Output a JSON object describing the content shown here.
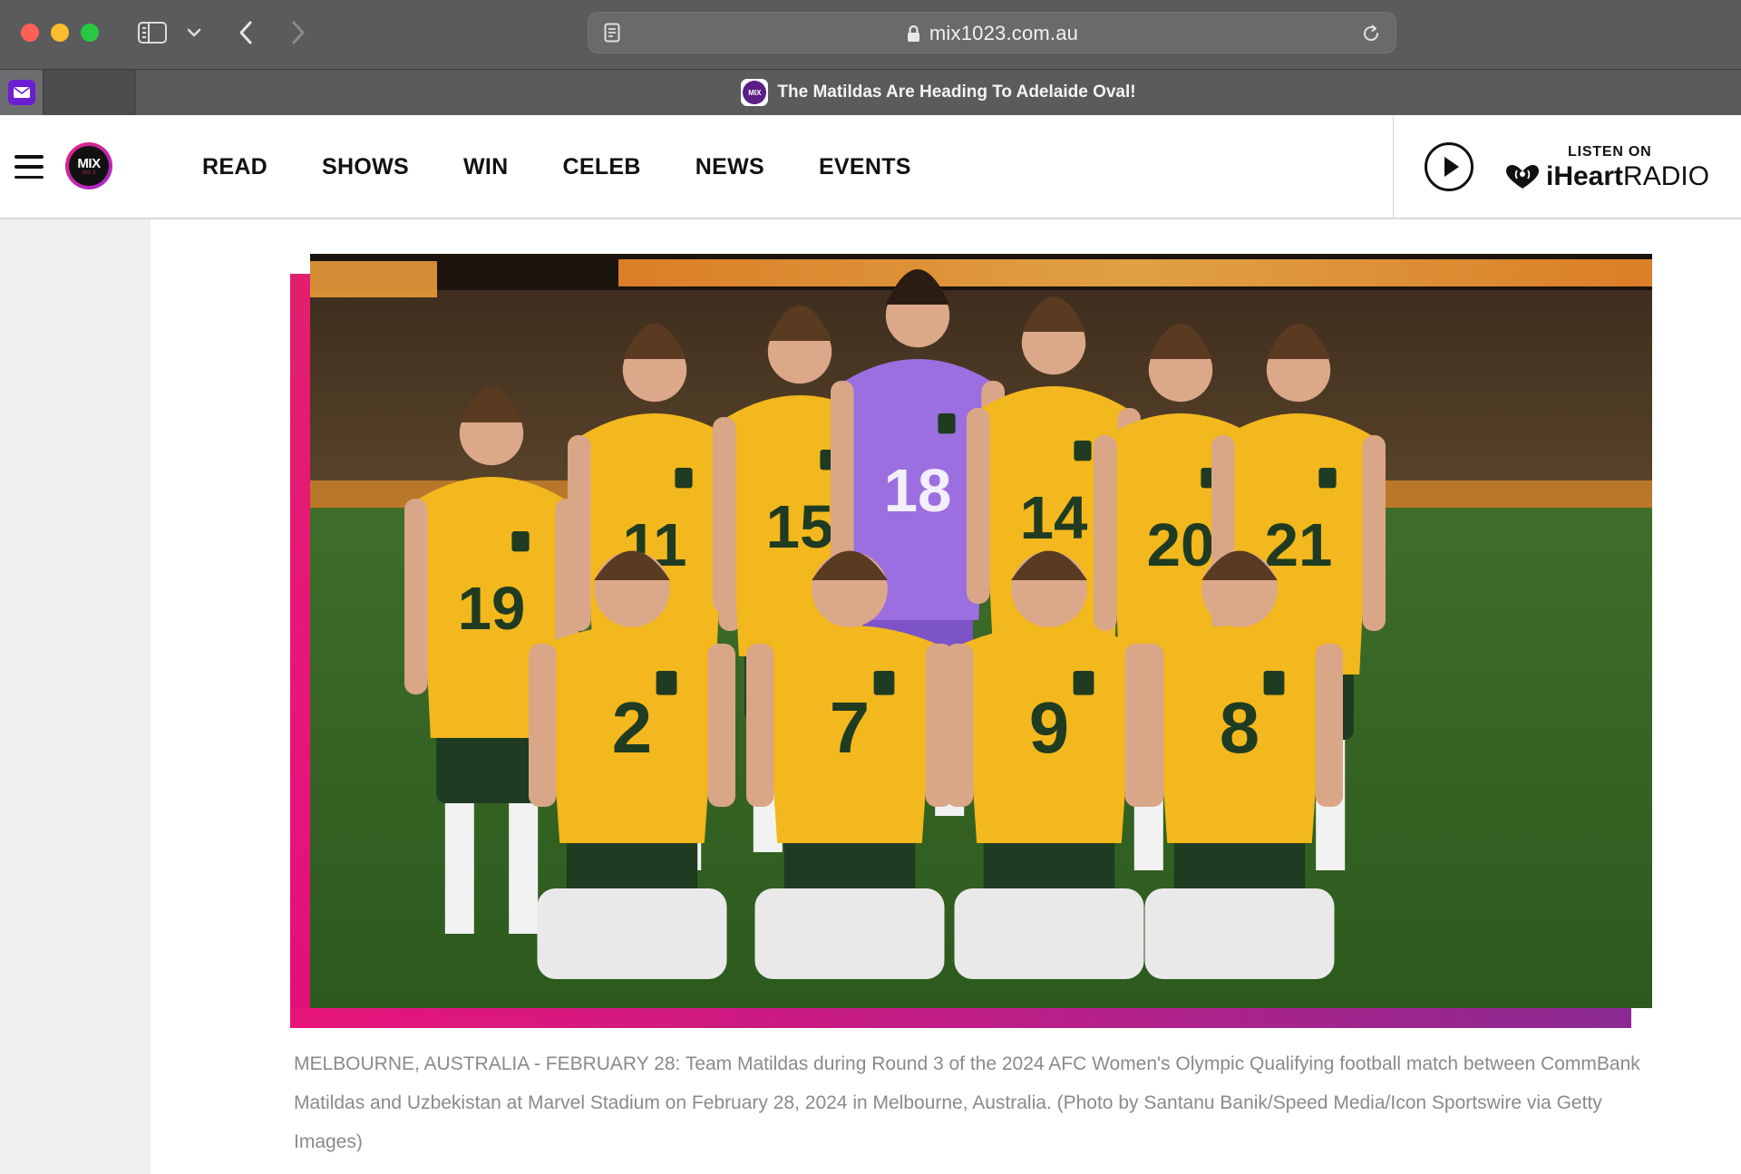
{
  "browser": {
    "url": "mix1023.com.au",
    "active_tab_title": "The Matildas Are Heading To Adelaide Oval!",
    "tab_favicon_text": "MIX"
  },
  "site": {
    "logo_word": "MIX",
    "logo_freq": "102.3",
    "nav": [
      "READ",
      "SHOWS",
      "WIN",
      "CELEB",
      "NEWS",
      "EVENTS"
    ],
    "listen_on": "LISTEN ON",
    "iheart_bold": "iHeart",
    "iheart_light": "RADIO"
  },
  "article": {
    "image_alt": "Team Matildas squad photo",
    "caption": "MELBOURNE, AUSTRALIA - FEBRUARY 28: Team Matildas during Round 3 of the 2024 AFC Women's Olympic Qualifying football match between CommBank Matildas and Uzbekistan at Marvel Stadium on February 28, 2024 in Melbourne, Australia. (Photo by Santanu Banik/Speed Media/Icon Sportswire via Getty Images)",
    "jersey_numbers_back": [
      "19",
      "11",
      "15",
      "18",
      "14",
      "20",
      "21"
    ],
    "jersey_numbers_front": [
      "2",
      "7",
      "9",
      "8"
    ]
  },
  "colors": {
    "brand_pink": "#e8157a",
    "brand_purple": "#8a2a92",
    "jersey_gold": "#f2b81d",
    "jersey_green": "#1f3b22",
    "keeper_purple": "#9b6fe0"
  }
}
